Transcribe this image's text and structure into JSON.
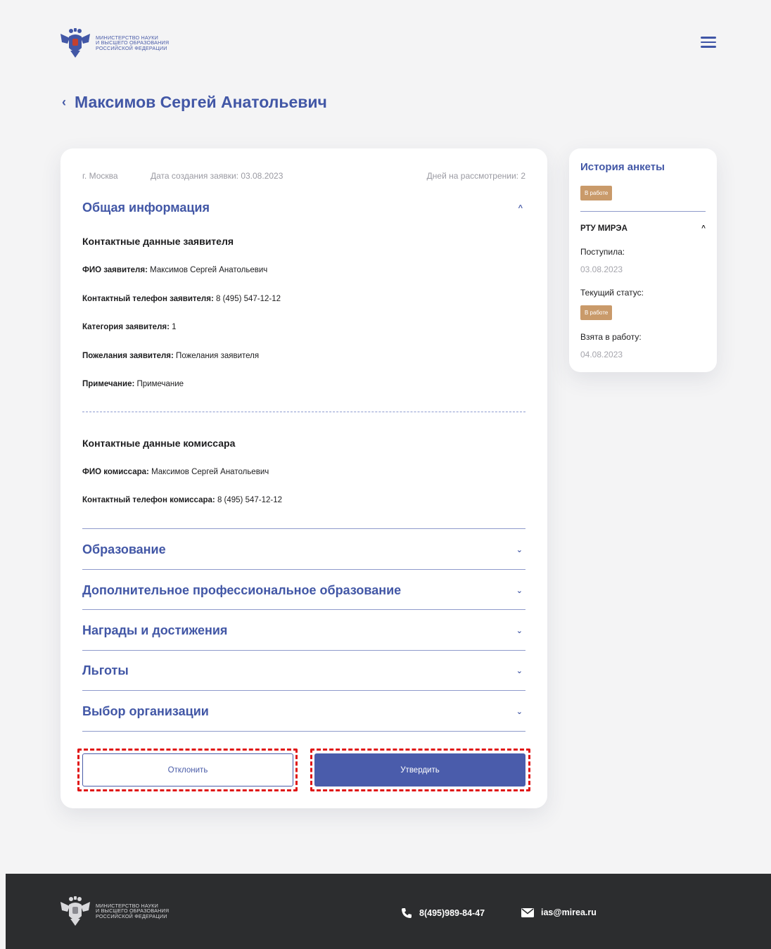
{
  "header": {
    "logo_text": "МИНИСТЕРСТВО НАУКИ\nИ ВЫСШЕГО ОБРАЗОВАНИЯ\nРОССИЙСКОЙ ФЕДЕРАЦИИ",
    "menu_icon": "hamburger-icon"
  },
  "page": {
    "title": "Максимов Сергей Анатольевич",
    "back_icon": "‹"
  },
  "main": {
    "city": "г. Москва",
    "created": "Дата создания заявки: 03.08.2023",
    "days": "Дней на рассмотрении: 2",
    "general": {
      "title": "Общая информация",
      "chevron": "^",
      "applicant_heading": "Контактные данные заявителя",
      "fields": [
        {
          "label": "ФИО заявителя:",
          "value": "Максимов Сергей Анатольевич"
        },
        {
          "label": "Контактный телефон заявителя:",
          "value": "8 (495) 547-12-12"
        },
        {
          "label": "Категория заявителя:",
          "value": "1"
        },
        {
          "label": "Пожелания заявителя:",
          "value": "Пожелания заявителя"
        },
        {
          "label": "Примечание:",
          "value": "Примечание"
        }
      ],
      "commissar_heading": "Контактные данные комиссара",
      "commissar_fields": [
        {
          "label": "ФИО комиссара:",
          "value": "Максимов Сергей Анатольевич"
        },
        {
          "label": "Контактный телефон комиссара:",
          "value": "8 (495) 547-12-12"
        }
      ]
    },
    "sections": [
      {
        "title": "Образование"
      },
      {
        "title": "Дополнительное профессиональное образование"
      },
      {
        "title": "Награды и достижения"
      },
      {
        "title": "Льготы"
      },
      {
        "title": "Выбор организации"
      }
    ],
    "section_chevron": "⌄",
    "reject_label": "Отклонить",
    "approve_label": "Утвердить"
  },
  "side": {
    "title": "История анкеты",
    "status_badge": "В работе",
    "org": "РТУ МИРЭА",
    "org_chevron": "^",
    "received_label": "Поступила:",
    "received_date": "03.08.2023",
    "current_status_label": "Текущий статус:",
    "current_status": "В работе",
    "taken_label": "Взята в работу:",
    "taken_date": "04.08.2023"
  },
  "footer": {
    "logo_text": "МИНИСТЕРСТВО НАУКИ\nИ ВЫСШЕГО ОБРАЗОВАНИЯ\nРОССИЙСКОЙ ФЕДЕРАЦИИ",
    "phone": "8(495)989-84-47",
    "email": "ias@mirea.ru"
  },
  "colors": {
    "accent": "#4257a6",
    "badge": "#c99a6a",
    "footer_bg": "#2c2d2f",
    "highlight": "#e01616"
  }
}
